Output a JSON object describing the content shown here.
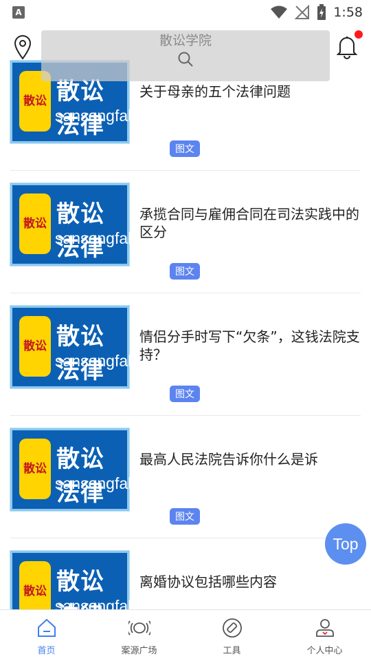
{
  "status_bar": {
    "left_icon": "A",
    "time": "1:58"
  },
  "header": {
    "title": "散讼学院",
    "location_icon": "location-pin-icon",
    "search_icon": "search-icon",
    "notification_icon": "bell-icon"
  },
  "articles": [
    {
      "title": "关于母亲的五个法律问题",
      "tag": "图文",
      "thumb": {
        "seal": "散讼",
        "brand_cn": "散讼法律",
        "brand_en": "sansongfalv"
      }
    },
    {
      "title": "承揽合同与雇佣合同在司法实践中的区分",
      "tag": "图文",
      "thumb": {
        "seal": "散讼",
        "brand_cn": "散讼法律",
        "brand_en": "sansongfalv"
      }
    },
    {
      "title": "情侣分手时写下“欠条”，这钱法院支持？",
      "tag": "图文",
      "thumb": {
        "seal": "散讼",
        "brand_cn": "散讼法律",
        "brand_en": "sansongfalv"
      }
    },
    {
      "title": "最高人民法院告诉你什么是诉",
      "tag": "图文",
      "thumb": {
        "seal": "散讼",
        "brand_cn": "散讼法律",
        "brand_en": "sansongfalv"
      }
    },
    {
      "title": "离婚协议包括哪些内容",
      "tag": "",
      "thumb": {
        "seal": "散讼",
        "brand_cn": "散讼法律",
        "brand_en": "sansongfalv"
      }
    }
  ],
  "top_button": "Top",
  "bottom_nav": [
    {
      "label": "首页",
      "icon": "home-icon",
      "active": true
    },
    {
      "label": "案源广场",
      "icon": "broadcast-icon",
      "active": false
    },
    {
      "label": "工具",
      "icon": "tools-icon",
      "active": false
    },
    {
      "label": "个人中心",
      "icon": "profile-icon",
      "active": false
    }
  ],
  "colors": {
    "accent": "#3f7ff0",
    "tag_bg": "#5c84f0",
    "thumb_bg": "#0b60b4",
    "seal_bg": "#ffd400",
    "notification_dot": "#ff1a1a"
  }
}
